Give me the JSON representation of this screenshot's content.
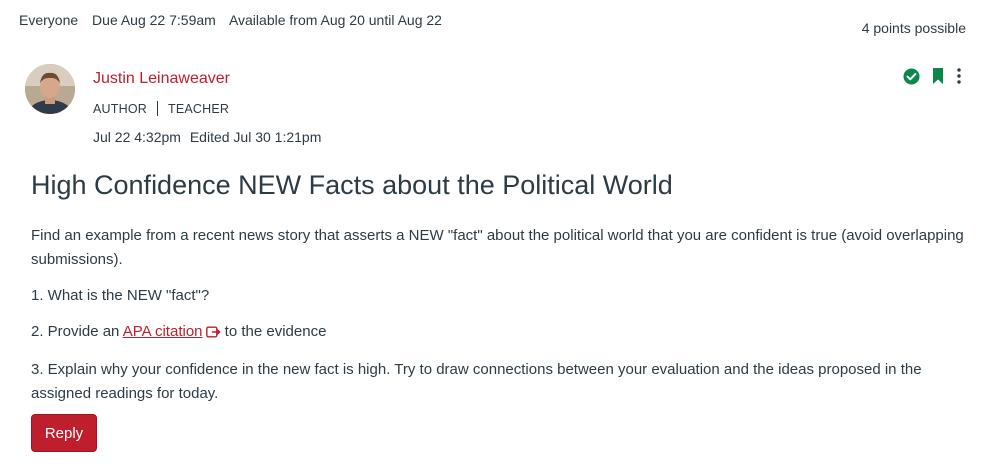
{
  "meta": {
    "audience": "Everyone",
    "due": "Due Aug 22 7:59am",
    "available": "Available from Aug 20 until Aug 22",
    "points": "4 points possible"
  },
  "author": {
    "name": "Justin Leinaweaver",
    "role1": "AUTHOR",
    "role2": "TEACHER",
    "posted": "Jul 22 4:32pm",
    "edited": "Edited Jul 30 1:21pm"
  },
  "actions": {
    "published_icon": "check-circle-icon",
    "bookmark_icon": "bookmark-icon",
    "menu_icon": "kebab-menu-icon",
    "accent": "#0b874b"
  },
  "post": {
    "title": "High Confidence NEW Facts about the Political World",
    "intro": "Find an example from a recent news story that asserts a NEW \"fact\" about the political world that you are confident is true (avoid overlapping submissions).",
    "q1": "1. What is the NEW \"fact\"?",
    "q2_before": "2. Provide an ",
    "q2_link": "APA citation",
    "q2_after": " to the evidence",
    "q3": "3. Explain why your confidence in the new fact is high. Try to draw connections between your evaluation and the ideas proposed in the assigned readings for today."
  },
  "reply_label": "Reply",
  "colors": {
    "brand": "#bf1e2d",
    "text": "#2d3b45",
    "success": "#0b874b"
  }
}
